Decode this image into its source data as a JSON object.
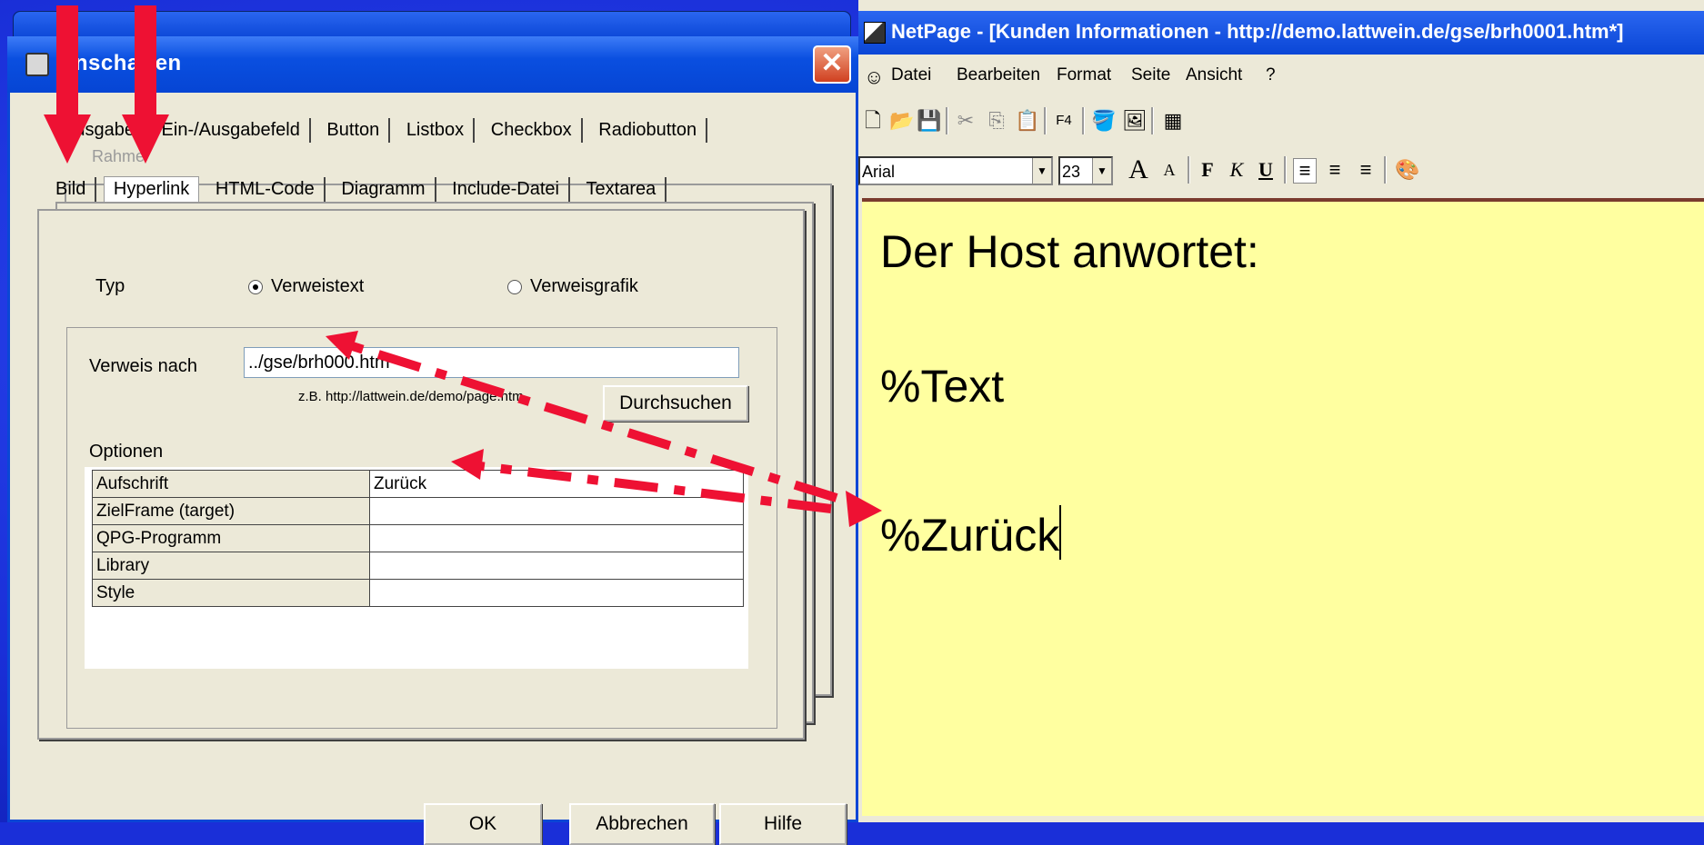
{
  "dialog": {
    "title": "enschaften",
    "close_glyph": "✕",
    "tabs_row1": [
      "Ausgabe",
      "Ein-/Ausgabefeld",
      "Button",
      "Listbox",
      "Checkbox",
      "Radiobutton"
    ],
    "tabs_row1_partial": "Rahme",
    "tabs_row2": [
      "Bild",
      "Hyperlink",
      "HTML-Code",
      "Diagramm",
      "Include-Datei",
      "Textarea"
    ],
    "active_tab": "Hyperlink",
    "typ_label": "Typ",
    "radio_text": "Verweistext",
    "radio_graphic": "Verweisgrafik",
    "verweis_label": "Verweis nach",
    "verweis_value": "../gse/brh000.htm",
    "example_hint": "z.B. http://lattwein.de/demo/page.htm",
    "browse_button": "Durchsuchen",
    "options_label": "Optionen",
    "options": [
      {
        "key": "Aufschrift",
        "value": "Zurück"
      },
      {
        "key": "ZielFrame (target)",
        "value": ""
      },
      {
        "key": "QPG-Programm",
        "value": ""
      },
      {
        "key": "Library",
        "value": ""
      },
      {
        "key": "Style",
        "value": ""
      }
    ],
    "ok_button": "OK",
    "cancel_button": "Abbrechen",
    "help_button": "Hilfe"
  },
  "editor": {
    "title": "NetPage - [Kunden Informationen - http://demo.lattwein.de/gse/brh0001.htm*]",
    "menu": [
      "Datei",
      "Bearbeiten",
      "Format",
      "Seite",
      "Ansicht",
      "?"
    ],
    "font_name": "Arial",
    "font_size": "23",
    "format_buttons": [
      "F",
      "K",
      "U"
    ],
    "content_lines": [
      "Der Host anwortet:",
      "%Text",
      "%Zurück"
    ]
  },
  "annotations": {
    "arrow_color": "#ee1133"
  },
  "icons": [
    "close-icon",
    "new-file-icon",
    "open-folder-icon",
    "save-icon",
    "cut-icon",
    "copy-icon",
    "paste-icon",
    "f4-icon",
    "paint-icon",
    "image-icon",
    "table-icon",
    "grow-font-icon",
    "shrink-font-icon",
    "align-left-icon",
    "align-center-icon",
    "align-right-icon",
    "palette-icon"
  ]
}
